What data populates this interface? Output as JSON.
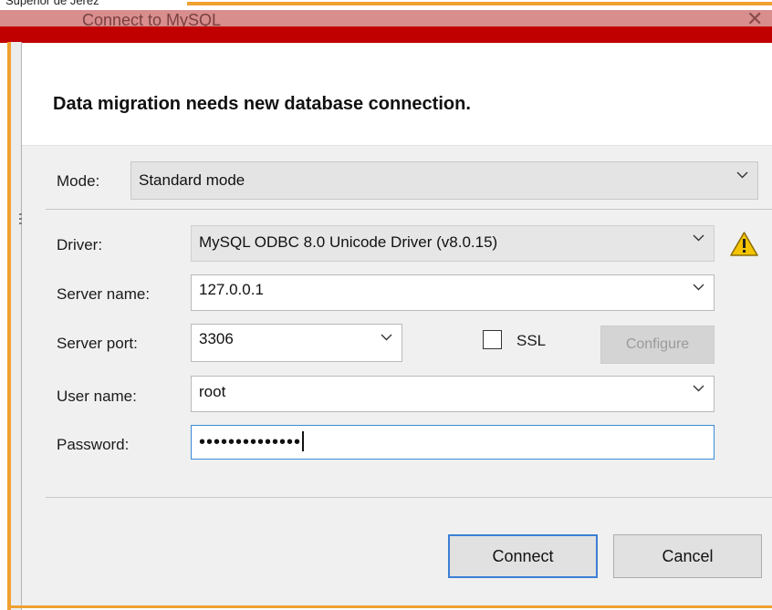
{
  "background_window": {
    "caption_text": "Superior de Jerez",
    "dialog_title": "Connect to MySQL",
    "close_glyph": "✕"
  },
  "heading": "Data migration needs new database connection.",
  "mode": {
    "label": "Mode:",
    "value": "Standard mode"
  },
  "form": {
    "driver": {
      "label": "Driver:",
      "value": "MySQL ODBC 8.0 Unicode Driver (v8.0.15)"
    },
    "server_name": {
      "label": "Server name:",
      "value": "127.0.0.1"
    },
    "server_port": {
      "label": "Server port:",
      "value": "3306"
    },
    "ssl": {
      "label": "SSL",
      "checked": false
    },
    "configure_label": "Configure",
    "user_name": {
      "label": "User name:",
      "value": "root"
    },
    "password": {
      "label": "Password:",
      "value": "••••••••••••••"
    }
  },
  "buttons": {
    "connect": "Connect",
    "cancel": "Cancel"
  },
  "icons": {
    "warning": "warning-icon",
    "dropdown": "chevron-down-icon",
    "menu": "hamburger-icon"
  },
  "colors": {
    "accent_blue": "#3b7fd4",
    "error_red": "#c00000",
    "orange_border": "#f0a030",
    "warning_yellow": "#f5c400"
  }
}
